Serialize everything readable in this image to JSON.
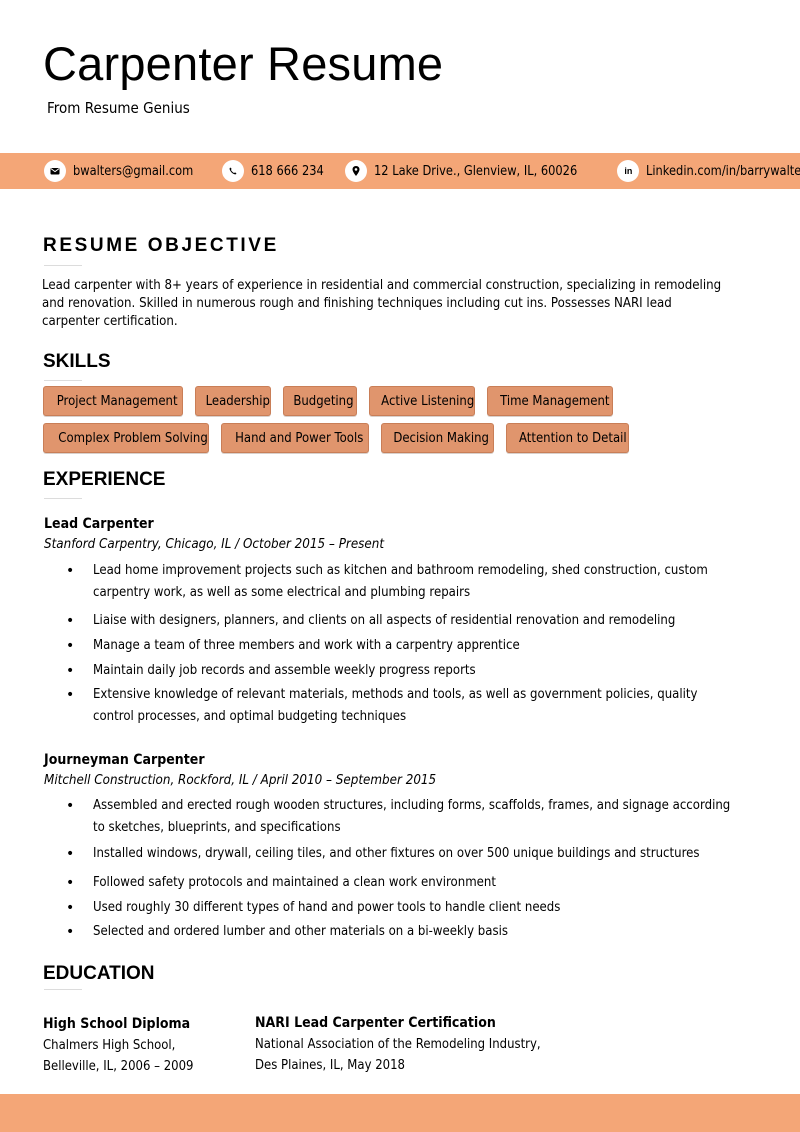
{
  "header": {
    "title": "Carpenter Resume",
    "subtitle": "From Resume Genius"
  },
  "contact": {
    "items": [
      {
        "icon": "envelope-icon",
        "text": "bwalters@gmail.com"
      },
      {
        "icon": "phone-icon",
        "text": "618 666 234"
      },
      {
        "icon": "location-pin-icon",
        "text": "12 Lake Drive., Glenview, IL, 60026"
      },
      {
        "icon": "linkedin-icon",
        "glyph": "in",
        "text": "Linkedin.com/in/barrywalters"
      }
    ]
  },
  "objective": {
    "heading": "RESUME OBJECTIVE",
    "lines": [
      "Lead carpenter with 8+ years of experience in residential and commercial construction, specializing in remodeling",
      "and renovation. Skilled in numerous rough and finishing techniques including cut ins. Possesses NARI lead",
      "carpenter certification."
    ]
  },
  "skills": {
    "heading": "SKILLS",
    "row1": [
      "Project Management",
      "Leadership",
      "Budgeting",
      "Active Listening",
      "Time Management"
    ],
    "row2": [
      "Complex Problem Solving",
      "Hand and Power Tools",
      "Decision Making",
      "Attention to Detail"
    ]
  },
  "experience": {
    "heading": "EXPERIENCE",
    "jobs": [
      {
        "title": "Lead Carpenter",
        "meta": "Stanford Carpentry, Chicago, IL  /  October 2015 – Present",
        "bullets": [
          [
            "Lead home improvement projects such as kitchen and bathroom remodeling, shed construction, custom",
            "carpentry work, as well as some electrical and plumbing repairs"
          ],
          [
            "Liaise with designers, planners, and clients on all aspects of residential renovation and remodeling"
          ],
          [
            "Manage a team of three members and work with a carpentry apprentice"
          ],
          [
            "Maintain daily job records and assemble weekly progress reports"
          ],
          [
            "Extensive knowledge of relevant materials, methods and tools, as well as government policies, quality",
            "control processes, and optimal budgeting techniques"
          ]
        ]
      },
      {
        "title": "Journeyman Carpenter",
        "meta": "Mitchell Construction, Rockford, IL  /  April 2010 – September 2015",
        "bullets": [
          [
            "Assembled and erected rough wooden structures, including forms, scaffolds, frames, and signage according",
            "to sketches, blueprints, and specifications"
          ],
          [
            "Installed windows, drywall, ceiling tiles, and other fixtures on over 500 unique buildings and structures"
          ],
          [
            "Followed safety protocols and maintained a clean work environment"
          ],
          [
            "Used roughly 30 different types of hand and power tools to handle client needs"
          ],
          [
            "Selected and ordered lumber and other materials on a bi-weekly basis"
          ]
        ]
      }
    ]
  },
  "education": {
    "heading": "EDUCATION",
    "entries": [
      {
        "degree": "High School Diploma",
        "line1": "Chalmers High School,",
        "line2": "Belleville, IL, 2006 – 2009"
      },
      {
        "degree": "NARI Lead Carpenter Certification",
        "line1": "National Association of the Remodeling Industry,",
        "line2": "Des Plaines, IL, May 2018"
      }
    ]
  },
  "colors": {
    "accent_bar": "#f4a677",
    "skill_tag": "#e0956d",
    "text": "#000000"
  }
}
